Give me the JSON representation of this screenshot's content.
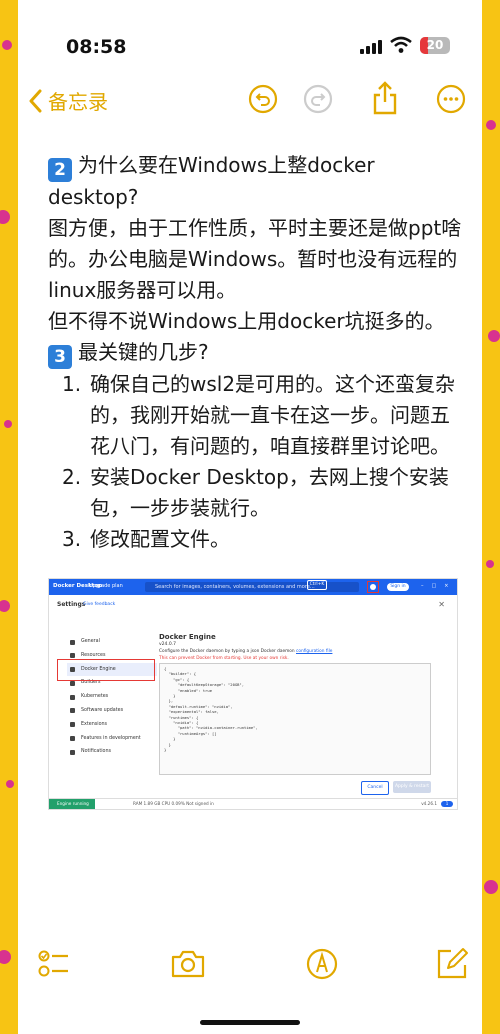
{
  "status": {
    "time": "08:58",
    "battery": "20"
  },
  "nav": {
    "back_label": "备忘录"
  },
  "note": {
    "h2_num": "2",
    "h2_text": "为什么要在Windows上整docker desktop?",
    "p1": "图方便，由于工作性质，平时主要还是做ppt啥的。办公电脑是Windows。暂时也没有远程的linux服务器可以用。",
    "p2": "但不得不说Windows上用docker坑挺多的。",
    "h3_num": "3",
    "h3_text": "最关键的几步?",
    "steps": [
      {
        "n": "1.",
        "text": "确保自己的wsl2是可用的。这个还蛮复杂的，我刚开始就一直卡在这一步。问题五花八门，有问题的，咱直接群里讨论吧。"
      },
      {
        "n": "2.",
        "text": "安装Docker Desktop，去网上搜个安装包，一步步装就行。"
      },
      {
        "n": "3.",
        "text": "修改配置文件。"
      }
    ]
  },
  "screenshot": {
    "brand": "Docker Desktop",
    "upgrade": "Upgrade plan",
    "search_placeholder": "Search for images, containers, volumes, extensions and more...",
    "ctrl": "Ctrl+K",
    "signin": "Sign in",
    "settings_title": "Settings",
    "feedback": "Give feedback",
    "sidebar": [
      "General",
      "Resources",
      "Docker Engine",
      "Builders",
      "Kubernetes",
      "Software updates",
      "Extensions",
      "Features in development",
      "Notifications"
    ],
    "engine_title": "Docker Engine",
    "engine_version": "v24.0.7",
    "engine_desc": "Configure the Docker daemon by typing a json Docker daemon ",
    "engine_desc_link": "configuration file",
    "engine_warn": "This can prevent Docker from starting. Use at your own risk.",
    "editor_text": "{\n  \"builder\": {\n    \"gc\": {\n      \"defaultKeepStorage\": \"20GB\",\n      \"enabled\": true\n    }\n  },\n  \"default-runtime\": \"nvidia\",\n  \"experimental\": false,\n  \"runtimes\": {\n    \"nvidia\": {\n      \"path\": \"nvidia-container-runtime\",\n      \"runtimeArgs\": []\n    }\n  }\n}",
    "cancel": "Cancel",
    "apply": "Apply & restart",
    "engine_running": "Engine running",
    "stats": "RAM 1.89 GB   CPU 0.09%   Not signed in",
    "version": "v4.26.1",
    "notif_count": "1"
  },
  "colors": {
    "accent": "#e1a800",
    "docker_blue": "#1d63ed",
    "highlight_red": "#e53935"
  },
  "icons": [
    "chevron-left-icon",
    "undo-icon",
    "redo-icon",
    "share-icon",
    "more-icon",
    "checklist-icon",
    "camera-icon",
    "markup-icon",
    "compose-icon"
  ]
}
